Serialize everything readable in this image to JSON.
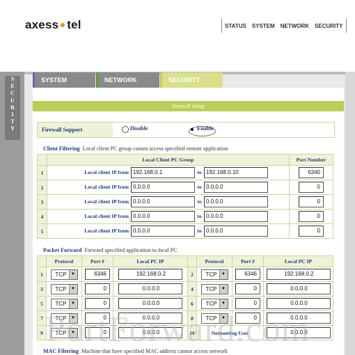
{
  "brand": {
    "name_left": "axess",
    "name_right": "tel"
  },
  "top_nav": [
    "STATUS",
    "SYSTEM",
    "NETWORK",
    "SECURITY"
  ],
  "side_label": [
    "S",
    "E",
    "C",
    "U",
    "R",
    "I",
    "T",
    "Y"
  ],
  "tabs": {
    "system": "SYSTEM",
    "network": "NETWORK",
    "security": "SECURITY"
  },
  "firewall_setup_title": "Firewall Setup",
  "firewall_support": {
    "label": "Firewall Support",
    "disable": "Disable",
    "enable": "Enable",
    "selected": "Enable"
  },
  "client_filtering": {
    "title": "Client Filtering",
    "desc": "Local client PC group cannot access specified remote application",
    "header_group": "Local Client PC Group",
    "header_port": "Port Number",
    "from_label": "Local client IP from",
    "to_label": "to",
    "rows": [
      {
        "n": "1",
        "from": "192.168.0.1",
        "to": "192.168.0.10",
        "port": "6340"
      },
      {
        "n": "2",
        "from": "0.0.0.0",
        "to": "0.0.0.0",
        "port": "0"
      },
      {
        "n": "3",
        "from": "0.0.0.0",
        "to": "0.0.0.0",
        "port": "0"
      },
      {
        "n": "4",
        "from": "0.0.0.0",
        "to": "0.0.0.0",
        "port": "0"
      },
      {
        "n": "5",
        "from": "0.0.0.0",
        "to": "0.0.0.0",
        "port": "0"
      }
    ]
  },
  "packet_forward": {
    "title": "Packet Forward",
    "desc": "Forward specified application to local PC",
    "headers": {
      "protocol": "Protocol",
      "port": "Port #",
      "ip": "Local PC IP"
    },
    "left_rows": [
      {
        "n": "1",
        "proto": "TCP",
        "port": "6346",
        "ip": "192.168.0.2"
      },
      {
        "n": "3",
        "proto": "TCP",
        "port": "0",
        "ip": "0.0.0.0"
      },
      {
        "n": "5",
        "proto": "TCP",
        "port": "0",
        "ip": "0.0.0.0"
      },
      {
        "n": "7",
        "proto": "TCP",
        "port": "0",
        "ip": "0.0.0.0"
      },
      {
        "n": "9",
        "proto": "TCP",
        "port": "0",
        "ip": "0.0.0.0"
      }
    ],
    "right_rows": [
      {
        "n": "2",
        "proto": "TCP",
        "port": "6346",
        "ip": "192.168.0.2"
      },
      {
        "n": "4",
        "proto": "TCP",
        "port": "0",
        "ip": "0.0.0.0"
      },
      {
        "n": "6",
        "proto": "TCP",
        "port": "0",
        "ip": "0.0.0.0"
      },
      {
        "n": "8",
        "proto": "TCP",
        "port": "0",
        "ip": "0.0.0.0"
      }
    ],
    "netmeeting": {
      "n": "10",
      "label": "Netmeeting User",
      "ip": "0.0.0.0"
    }
  },
  "mac_filtering": {
    "title": "MAC Filtering",
    "desc": "Machine that have specified MAC address cannot access network"
  },
  "watermark": "PortForward.com",
  "colors": {
    "accent_green": "#b9cf5a",
    "label_blue": "#1f3a7a",
    "side_gray": "#9c9c9c"
  }
}
